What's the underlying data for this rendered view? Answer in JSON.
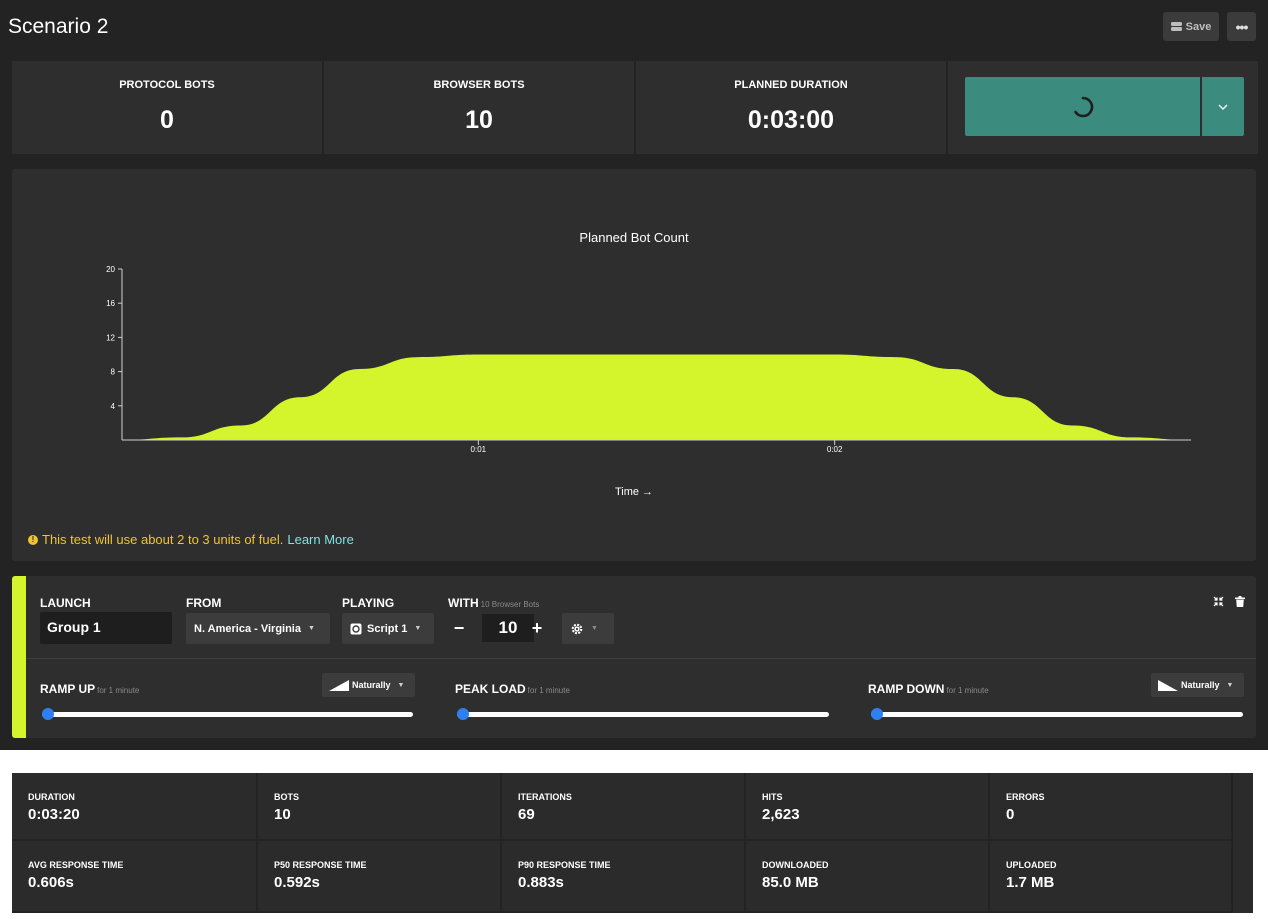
{
  "header": {
    "title": "Scenario 2",
    "save_label": "Save",
    "more_label": "•••"
  },
  "summary": {
    "protocol_bots_label": "PROTOCOL BOTS",
    "protocol_bots_value": "0",
    "browser_bots_label": "BROWSER BOTS",
    "browser_bots_value": "10",
    "planned_duration_label": "PLANNED DURATION",
    "planned_duration_value": "0:03:00"
  },
  "chart_data": {
    "type": "area",
    "title": "Planned Bot Count",
    "xlabel": "Time →",
    "ylabel": "",
    "x_ticks": [
      "0:01",
      "0:02"
    ],
    "y_ticks": [
      4,
      8,
      12,
      16,
      20
    ],
    "ylim": [
      0,
      20
    ],
    "xlim_seconds": [
      0,
      180
    ],
    "x_seconds": [
      0,
      10,
      20,
      30,
      40,
      50,
      60,
      120,
      130,
      140,
      150,
      160,
      170,
      180
    ],
    "values": [
      0,
      0.3,
      1.7,
      5.0,
      8.3,
      9.7,
      10,
      10,
      9.7,
      8.3,
      5.0,
      1.7,
      0.3,
      0
    ],
    "series": [
      {
        "values": [
          0,
          0.3,
          1.7,
          5.0,
          8.3,
          9.7,
          10,
          10,
          9.7,
          8.3,
          5.0,
          1.7,
          0.3,
          0
        ]
      }
    ],
    "fill_color": "#d4f52c",
    "grid": false
  },
  "fuel_note": {
    "text": "This test will use about 2 to 3 units of fuel.",
    "link": "Learn More",
    "color": "#f2c330"
  },
  "group": {
    "launch_label": "LAUNCH",
    "group_name": "Group 1",
    "from_label": "FROM",
    "region": "N. America - Virginia",
    "playing_label": "PLAYING",
    "script": "Script 1",
    "with_label": "WITH",
    "with_hint": "10 Browser Bots",
    "bot_count": "10",
    "minus_label": "−",
    "plus_label": "+",
    "stripe_color": "#d4f52c",
    "ramp_up_label": "RAMP UP",
    "ramp_up_hint": "for 1 minute",
    "ramp_up_mode": "Naturally",
    "peak_load_label": "PEAK LOAD",
    "peak_load_hint": "for 1 minute",
    "ramp_down_label": "RAMP DOWN",
    "ramp_down_hint": "for 1 minute",
    "ramp_down_mode": "Naturally"
  },
  "results": [
    {
      "label": "DURATION",
      "value": "0:03:20"
    },
    {
      "label": "BOTS",
      "value": "10"
    },
    {
      "label": "ITERATIONS",
      "value": "69"
    },
    {
      "label": "HITS",
      "value": "2,623"
    },
    {
      "label": "ERRORS",
      "value": "0"
    },
    {
      "label": "AVG RESPONSE TIME",
      "value": "0.606s"
    },
    {
      "label": "P50 RESPONSE TIME",
      "value": "0.592s"
    },
    {
      "label": "P90 RESPONSE TIME",
      "value": "0.883s"
    },
    {
      "label": "DOWNLOADED",
      "value": "85.0 MB"
    },
    {
      "label": "UPLOADED",
      "value": "1.7 MB"
    }
  ],
  "colors": {
    "accent_launch": "#3b8c7e",
    "slider_knob": "#2e80f0",
    "panel_bg": "#2e2e2e",
    "app_bg": "#232323"
  }
}
